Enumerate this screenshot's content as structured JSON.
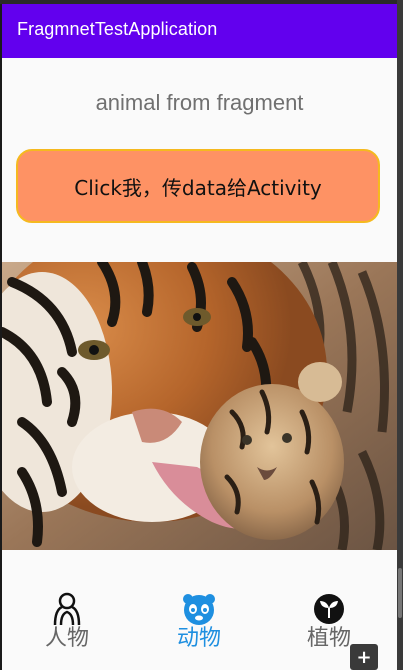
{
  "app": {
    "title": "FragmnetTestApplication"
  },
  "main": {
    "heading": "animal from fragment",
    "action_button_label": "Click我，传data给Activity"
  },
  "bottom_nav": {
    "items": [
      {
        "label": "人物",
        "icon": "people-icon",
        "active": false
      },
      {
        "label": "动物",
        "icon": "panda-icon",
        "active": true
      },
      {
        "label": "植物",
        "icon": "plant-icon",
        "active": false
      }
    ]
  },
  "overlay": {
    "add_label": "+"
  },
  "colors": {
    "appbar": "#6200ee",
    "button_fill": "#fe9264",
    "button_border": "#f5b91f",
    "nav_active": "#1e8fe0",
    "nav_inactive": "#666666"
  }
}
